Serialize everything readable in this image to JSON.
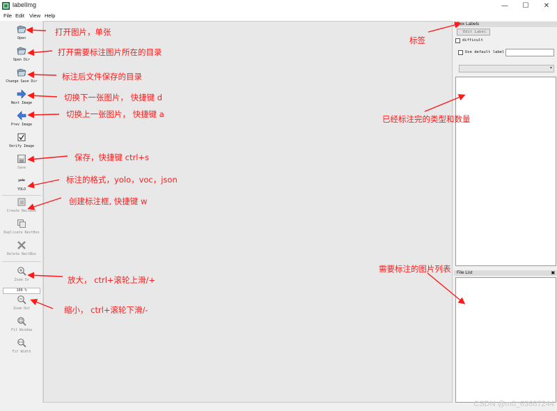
{
  "window": {
    "title": "labelImg",
    "controls": {
      "minimize": "—",
      "maximize": "☐",
      "close": "✕"
    }
  },
  "menu": [
    "File",
    "Edit",
    "View",
    "Help"
  ],
  "toolbar": {
    "items": [
      {
        "label": "Open",
        "icon": "folder-icon",
        "enabled": true
      },
      {
        "label": "Open Dir",
        "icon": "folder-icon",
        "enabled": true
      },
      {
        "label": "Change Save Dir",
        "icon": "folder-icon",
        "enabled": true
      },
      {
        "label": "Next Image",
        "icon": "arrow-right-icon",
        "enabled": true
      },
      {
        "label": "Prev Image",
        "icon": "arrow-left-icon",
        "enabled": true
      },
      {
        "label": "Verify Image",
        "icon": "checkbox-icon",
        "enabled": true
      },
      {
        "label": "Save",
        "icon": "save-icon",
        "enabled": false
      },
      {
        "label": "YOLO",
        "icon": "format-icon",
        "enabled": true
      },
      {
        "label": "Create RectBox",
        "icon": "rect-box-icon",
        "enabled": false
      },
      {
        "label": "Duplicate RectBox",
        "icon": "duplicate-icon",
        "enabled": false
      },
      {
        "label": "Delete RectBox",
        "icon": "delete-icon",
        "enabled": false
      },
      {
        "label": "Zoom In",
        "icon": "zoom-in-icon",
        "enabled": false
      },
      {
        "label": "Zoom Out",
        "icon": "zoom-out-icon",
        "enabled": false
      },
      {
        "label": "Fit Window",
        "icon": "fit-window-icon",
        "enabled": false
      },
      {
        "label": "Fit Width",
        "icon": "fit-width-icon",
        "enabled": false
      }
    ],
    "format_icon_text": "yolo",
    "zoom_level": "100 %"
  },
  "box_labels": {
    "title": "Box Labels",
    "edit_label": "Edit Label",
    "difficult": "difficult",
    "use_default_label": "Use default label",
    "default_label_value": ""
  },
  "file_list": {
    "title": "File List"
  },
  "annotations": [
    "打开图片，单张",
    "打开需要标注图片所在的目录",
    "标注后文件保存的目录",
    "切换下一张图片，  快捷键 d",
    "切换上一张图片，  快捷键 a",
    "保存，快捷键   ctrl+s",
    "标注的格式，yolo，voc，json",
    "创建标注框, 快捷键   w",
    "放大，  ctrl+滚轮上滑/+",
    "缩小，  ctrl+滚轮下滑/-",
    "标签",
    "已经标注完的类型和数量",
    "需要标注的图片列表"
  ],
  "watermark": "CSDN @m0_63687244",
  "colors": {
    "annotation": "#ff1a1a",
    "canvas": "#e8e8e8",
    "chrome": "#f0f0f0"
  }
}
